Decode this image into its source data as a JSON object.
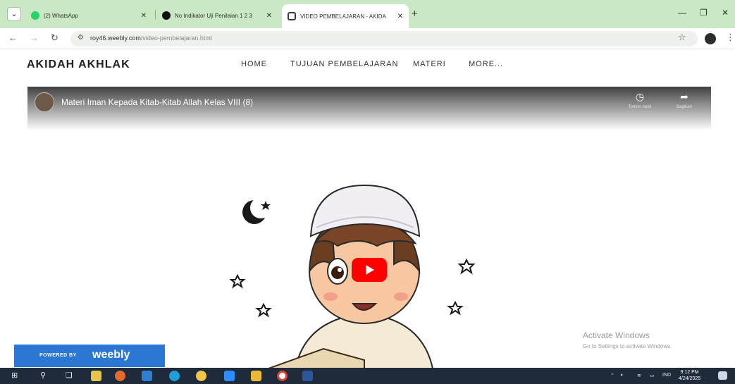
{
  "browser": {
    "tabs": [
      {
        "title": "(2) WhatsApp",
        "favicon_color": "#25d366"
      },
      {
        "title": "No Indikator Uji Penilaian 1 2 3",
        "favicon_color": "#111111"
      },
      {
        "title": "VIDEO PEMBELAJARAN - AKIDA",
        "favicon_color": "#3a3a3a",
        "active": true
      }
    ],
    "new_tab": "+",
    "url_host": "roy46.weebly.com",
    "url_path": "/video-pembelajaran.html"
  },
  "site": {
    "title": "AKIDAH AKHLAK",
    "menu": [
      "HOME",
      "TUJUAN PEMBELAJARAN",
      "MATERI",
      "MORE..."
    ]
  },
  "video": {
    "title": "Materi Iman Kepada Kitab-Kitab Allah Kelas VIII (8)",
    "watch_later": "Tonton nanti",
    "share": "Bagikan"
  },
  "watermark": {
    "line1": "Activate Windows",
    "line2": "Go to Settings to activate Windows."
  },
  "badge": {
    "prefix": "POWERED BY",
    "brand": "weebly"
  },
  "taskbar": {
    "lang": "IND",
    "time": "9:12 PM",
    "date": "4/24/2025"
  },
  "colors": {
    "tabbar": "#c9e8c3",
    "play": "#ff0000",
    "weebly": "#2b78d4",
    "taskbar": "#1f2a3a"
  },
  "icons": [
    "search-icon",
    "whatsapp-icon",
    "circle-favicon",
    "weebly-favicon",
    "back-icon",
    "forward-icon",
    "reload-icon",
    "star-icon",
    "profile-icon",
    "more-icon",
    "clock-icon",
    "share-icon",
    "play-icon",
    "windows-start-icon"
  ]
}
